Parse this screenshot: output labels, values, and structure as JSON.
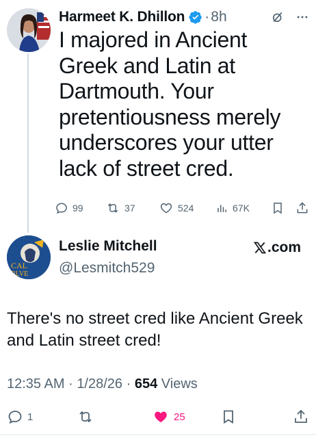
{
  "reply_tweet": {
    "author_name": "Harmeet K. Dhillon",
    "separator": "·",
    "time": "8h",
    "text": "I majored in Ancient Greek and Latin at Dartmouth. Your pretentiousness merely underscores your utter lack of street cred.",
    "actions": {
      "replies": "99",
      "retweets": "37",
      "likes": "524",
      "views": "67K"
    },
    "icons": [
      "verified-badge-icon",
      "grok-icon",
      "more-icon",
      "reply-icon",
      "retweet-icon",
      "like-icon",
      "views-icon",
      "bookmark-icon",
      "share-icon"
    ]
  },
  "main_tweet": {
    "author_name": "Leslie Mitchell",
    "handle": "@Lesmitch529",
    "avatar_text": "CAL\nBLVE",
    "text": "There's no street cred like Ancient Greek and Latin street cred!",
    "time": "12:35 AM",
    "date": "1/28/26",
    "separator": "·",
    "views_count": "654",
    "views_label": "Views",
    "actions": {
      "replies": "1",
      "likes": "25"
    }
  },
  "watermark": {
    "text": ".com",
    "logo": "x-logo"
  },
  "colors": {
    "text": "#0f1419",
    "secondary": "#536471",
    "verified": "#1d9bf0",
    "like": "#f91880",
    "divider": "#cfd9de"
  }
}
